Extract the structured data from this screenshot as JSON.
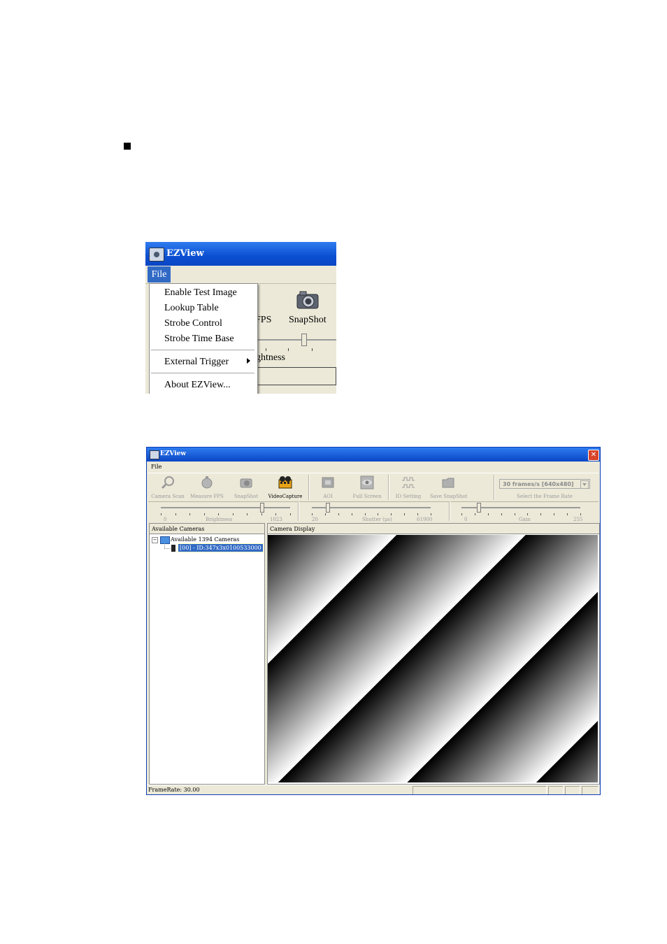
{
  "window1": {
    "title": "EZView",
    "menu_file": "File",
    "menu_items": [
      {
        "label": "Enable Test Image"
      },
      {
        "label": "Lookup Table"
      },
      {
        "label": "Strobe Control"
      },
      {
        "label": "Strobe Time Base"
      },
      {
        "label": "External Trigger",
        "submenu": true
      },
      {
        "label": "About EZView..."
      }
    ],
    "toolbar_fps_partial": "FPS",
    "toolbar_snapshot": "SnapShot",
    "brightness_partial": "ghtness"
  },
  "window2": {
    "title": "EZView",
    "menu_file": "File",
    "toolbar": [
      {
        "label": "Camera Scan",
        "icon": "magnifier-icon",
        "enabled": false
      },
      {
        "label": "Measure FPS",
        "icon": "stopwatch-icon",
        "enabled": false
      },
      {
        "label": "SnapShot",
        "icon": "camera-icon",
        "enabled": false
      },
      {
        "label": "VideoCapture",
        "icon": "film-reel-icon",
        "enabled": true
      },
      {
        "label": "AOI",
        "icon": "aoi-icon",
        "enabled": false
      },
      {
        "label": "Full Screen",
        "icon": "eye-icon",
        "enabled": false
      },
      {
        "label": "IO Setting",
        "icon": "gpio-icon",
        "enabled": false
      },
      {
        "label": "Save SnapShot",
        "icon": "folder-icon",
        "enabled": false
      }
    ],
    "frame_rate_select": "30 frames/s [640x480]",
    "frame_rate_caption": "Select the Frame Rate",
    "sliders": [
      {
        "name": "Brightness",
        "min": "0",
        "max": "1023",
        "value": 0.78
      },
      {
        "name": "Shutter (μs)",
        "min": "20",
        "max": "61900",
        "value": 0.13
      },
      {
        "name": "Gain",
        "min": "0",
        "max": "255",
        "value": 0.14
      }
    ],
    "left_panel_title": "Available Cameras",
    "tree_root": "Available 1394 Cameras",
    "tree_selected": "[00] - ID:347x3x0100533000",
    "display_title": "Camera Display",
    "status_text": "FrameRate: 30.00"
  }
}
